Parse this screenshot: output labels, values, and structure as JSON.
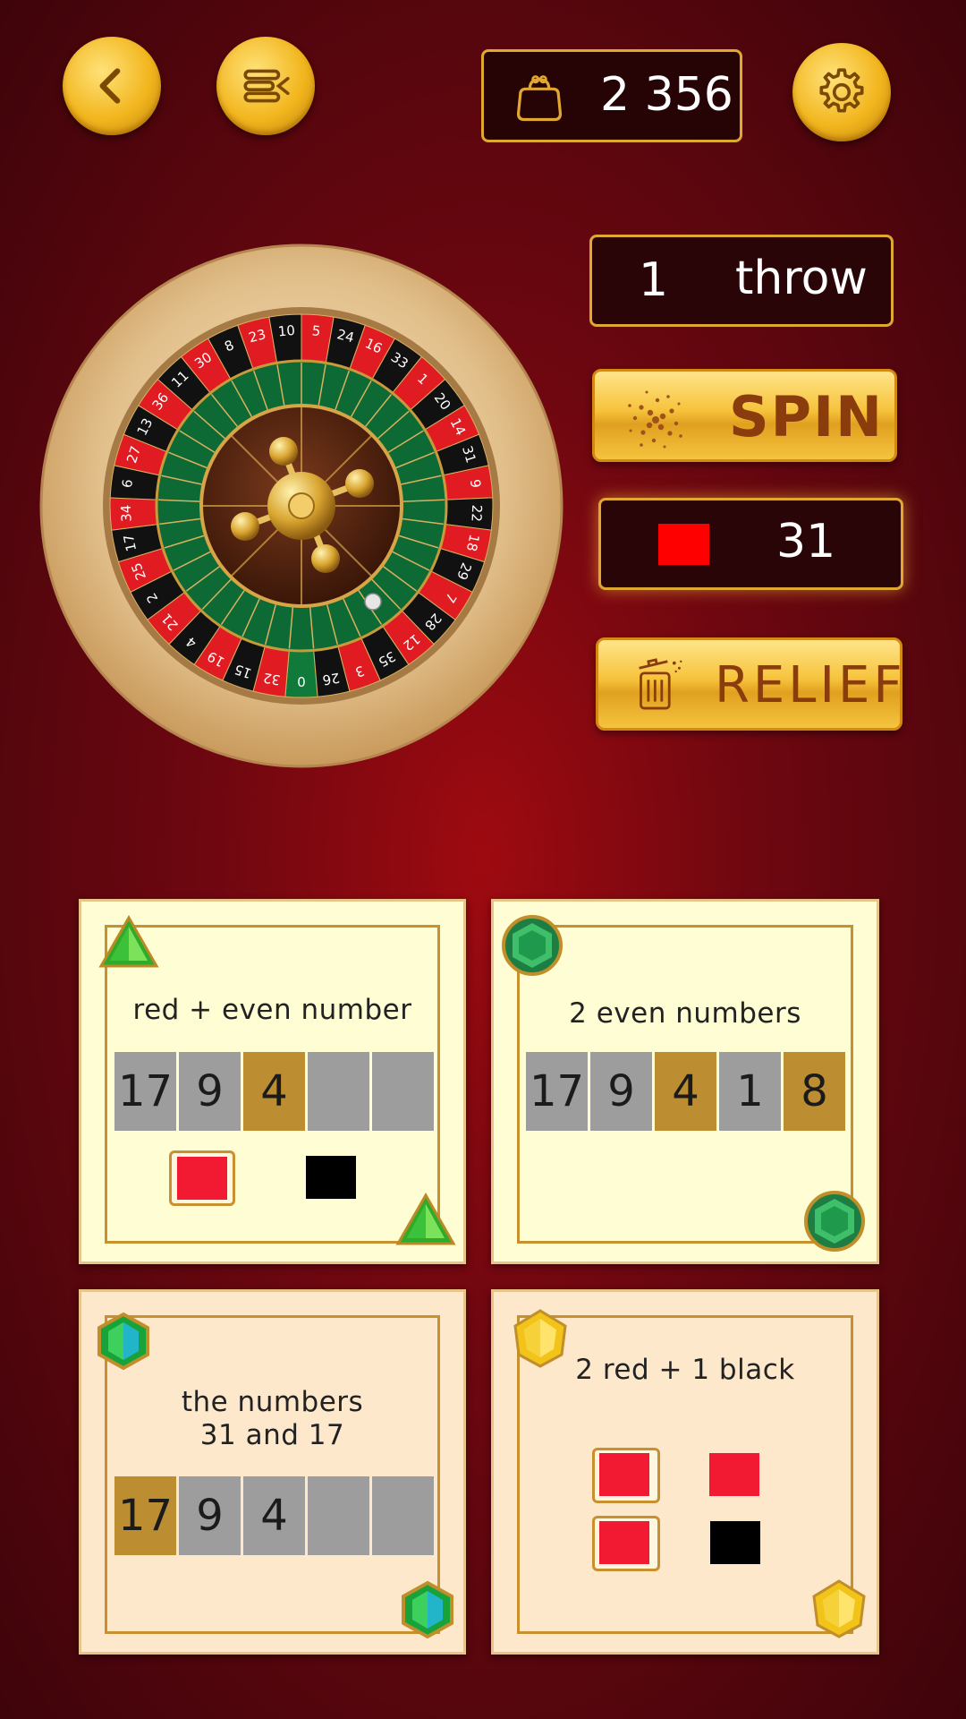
{
  "header": {
    "wallet_amount": "2 356"
  },
  "roulette": {
    "numbers": [
      "0",
      "32",
      "15",
      "19",
      "4",
      "21",
      "2",
      "25",
      "17",
      "34",
      "6",
      "27",
      "13",
      "36",
      "11",
      "30",
      "8",
      "23",
      "10",
      "5",
      "24",
      "16",
      "33",
      "1",
      "20",
      "14",
      "31",
      "9",
      "22",
      "18",
      "29",
      "7",
      "28",
      "12",
      "35",
      "3",
      "26"
    ],
    "colors": {
      "red": "#e11b22",
      "black": "#111111",
      "green": "#0f7a3a"
    }
  },
  "controls": {
    "throw_count": "1",
    "throw_label": "throw",
    "spin_label": "SPIN",
    "result_number": "31",
    "result_color": "#ff0000",
    "relief_label": "RELIEF"
  },
  "cards": [
    {
      "title": "red + even number",
      "slots": [
        {
          "value": "17",
          "state": "gray"
        },
        {
          "value": "9",
          "state": "gray"
        },
        {
          "value": "4",
          "state": "gold"
        },
        {
          "value": "",
          "state": "gray"
        },
        {
          "value": "",
          "state": "gray"
        }
      ],
      "gem": "green-triangle-gem-icon"
    },
    {
      "title": "2 even numbers",
      "slots": [
        {
          "value": "17",
          "state": "gray"
        },
        {
          "value": "9",
          "state": "gray"
        },
        {
          "value": "4",
          "state": "gold"
        },
        {
          "value": "1",
          "state": "gray"
        },
        {
          "value": "8",
          "state": "gold"
        }
      ],
      "gem": "emerald-gem-icon"
    },
    {
      "title_line1": "the numbers",
      "title_line2": "31 and 17",
      "slots": [
        {
          "value": "17",
          "state": "gold"
        },
        {
          "value": "9",
          "state": "gray"
        },
        {
          "value": "4",
          "state": "gray"
        },
        {
          "value": "",
          "state": "gray"
        },
        {
          "value": "",
          "state": "gray"
        }
      ],
      "gem": "green-blue-gem-icon"
    },
    {
      "title": "2 red + 1 black",
      "gem": "yellow-gem-icon"
    }
  ]
}
